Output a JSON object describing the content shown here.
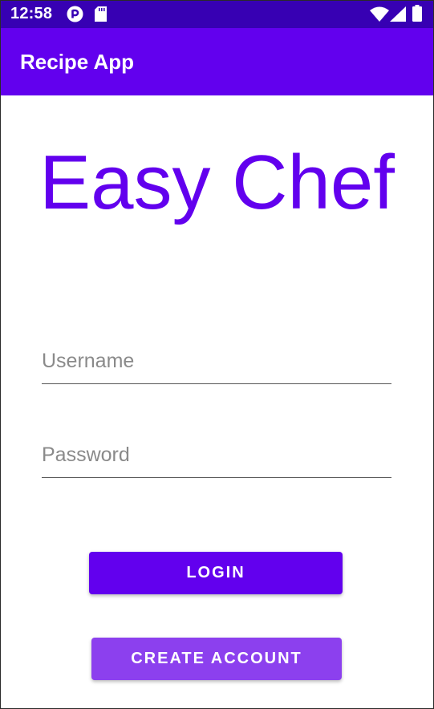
{
  "status_bar": {
    "time": "12:58",
    "icons": [
      "p-badge-icon",
      "sd-card-icon",
      "wifi-icon",
      "signal-icon",
      "battery-icon"
    ],
    "color": "#3700b3"
  },
  "app_bar": {
    "title": "Recipe App",
    "color": "#6200ee"
  },
  "main": {
    "hero_title": "Easy Chef",
    "username_field": {
      "placeholder": "Username",
      "value": ""
    },
    "password_field": {
      "placeholder": "Password",
      "value": ""
    },
    "login_button": {
      "label": "LOGIN",
      "color": "#6200ee"
    },
    "create_account_button": {
      "label": "CREATE ACCOUNT",
      "color": "#8c40ee"
    }
  }
}
